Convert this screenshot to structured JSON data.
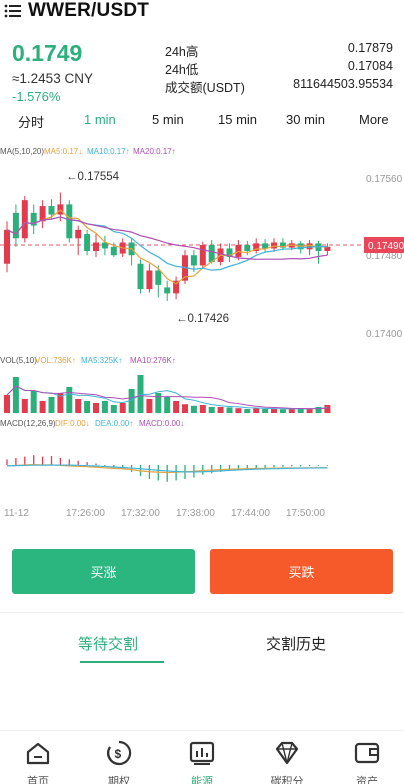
{
  "header": {
    "title": "WWER/USDT",
    "menu_icon": "menu-icon"
  },
  "ticker": {
    "last_price": "0.1749",
    "cny_price": "≈1.2453 CNY",
    "change_pct": "-1.576%",
    "stats": [
      {
        "label": "24h高",
        "value": "0.17879"
      },
      {
        "label": "24h低",
        "value": "0.17084"
      },
      {
        "label": "成交额(USDT)",
        "value": "811644503.95534"
      }
    ]
  },
  "intervals": {
    "items": [
      "分时",
      "1 min",
      "5 min",
      "15 min",
      "30 min",
      "More"
    ],
    "active": "1 min"
  },
  "chart": {
    "ma_legend": {
      "prefix": "MA(5,10,20)",
      "ma5": "MA5:0.17↓",
      "ma10": "MA10:0.17↑",
      "ma20": "MA20:0.17↑"
    },
    "vol_legend": {
      "prefix": "VOL(5,10)",
      "vol": "VOL:736K↑",
      "ma5": "MA5:325K↑",
      "ma10": "MA10:276K↑"
    },
    "macd_legend": {
      "prefix": "MACD(12,26,9)",
      "dif": "DIF:0.00↓",
      "dea": "DEA:0.00↑",
      "macd": "MACD:0.00↓"
    },
    "price_axis": [
      "0.17560",
      "0.17480",
      "0.17400"
    ],
    "current_price_tag": "0.17490",
    "high_marker": "←0.17554",
    "low_marker": "←0.17426",
    "time_axis": [
      "11-12",
      "17:26:00",
      "17:32:00",
      "17:38:00",
      "17:44:00",
      "17:50:00"
    ]
  },
  "actions": {
    "buy_label": "买涨",
    "sell_label": "买跌"
  },
  "order_tabs": {
    "pending": "等待交割",
    "history": "交割历史"
  },
  "nav": {
    "items": [
      {
        "label": "首页",
        "icon": "home-icon"
      },
      {
        "label": "期权",
        "icon": "dollar-cycle-icon"
      },
      {
        "label": "能源",
        "icon": "chart-icon"
      },
      {
        "label": "碳积分",
        "icon": "diamond-icon"
      },
      {
        "label": "资产",
        "icon": "wallet-icon"
      }
    ],
    "active": "能源"
  },
  "chart_data": {
    "type": "candlestick",
    "up_color": "#e23b4e",
    "down_color": "#2bb07c",
    "ylim": [
      0.1738,
      0.1759
    ],
    "candles": [
      {
        "o": 0.1747,
        "c": 0.1751,
        "h": 0.1752,
        "l": 0.1746
      },
      {
        "o": 0.1753,
        "c": 0.175,
        "h": 0.1754,
        "l": 0.1749
      },
      {
        "o": 0.175,
        "c": 0.17545,
        "h": 0.1755,
        "l": 0.17495
      },
      {
        "o": 0.1753,
        "c": 0.17515,
        "h": 0.1754,
        "l": 0.17505
      },
      {
        "o": 0.1752,
        "c": 0.17538,
        "h": 0.17545,
        "l": 0.17512
      },
      {
        "o": 0.17538,
        "c": 0.17528,
        "h": 0.17546,
        "l": 0.17522
      },
      {
        "o": 0.17528,
        "c": 0.1754,
        "h": 0.17554,
        "l": 0.1752
      },
      {
        "o": 0.1754,
        "c": 0.175,
        "h": 0.17545,
        "l": 0.17495
      },
      {
        "o": 0.175,
        "c": 0.1751,
        "h": 0.17515,
        "l": 0.1748
      },
      {
        "o": 0.17505,
        "c": 0.17485,
        "h": 0.1751,
        "l": 0.1748
      },
      {
        "o": 0.17485,
        "c": 0.17495,
        "h": 0.17505,
        "l": 0.17478
      },
      {
        "o": 0.17495,
        "c": 0.17488,
        "h": 0.17503,
        "l": 0.1748
      },
      {
        "o": 0.1749,
        "c": 0.1748,
        "h": 0.17495,
        "l": 0.17478
      },
      {
        "o": 0.17482,
        "c": 0.17495,
        "h": 0.175,
        "l": 0.17478
      },
      {
        "o": 0.17495,
        "c": 0.1748,
        "h": 0.175,
        "l": 0.17468
      },
      {
        "o": 0.1747,
        "c": 0.1744,
        "h": 0.17475,
        "l": 0.17435
      },
      {
        "o": 0.1744,
        "c": 0.17462,
        "h": 0.1747,
        "l": 0.17436
      },
      {
        "o": 0.17462,
        "c": 0.17445,
        "h": 0.17468,
        "l": 0.1743
      },
      {
        "o": 0.17442,
        "c": 0.17435,
        "h": 0.1745,
        "l": 0.17426
      },
      {
        "o": 0.17435,
        "c": 0.1745,
        "h": 0.17455,
        "l": 0.17428
      },
      {
        "o": 0.1745,
        "c": 0.1748,
        "h": 0.17486,
        "l": 0.17446
      },
      {
        "o": 0.1748,
        "c": 0.17468,
        "h": 0.17486,
        "l": 0.1746
      },
      {
        "o": 0.17468,
        "c": 0.17492,
        "h": 0.17496,
        "l": 0.17464
      },
      {
        "o": 0.17492,
        "c": 0.17472,
        "h": 0.17498,
        "l": 0.1747
      },
      {
        "o": 0.17472,
        "c": 0.17488,
        "h": 0.17494,
        "l": 0.17468
      },
      {
        "o": 0.17488,
        "c": 0.17478,
        "h": 0.17494,
        "l": 0.17472
      },
      {
        "o": 0.17478,
        "c": 0.17492,
        "h": 0.17498,
        "l": 0.17474
      },
      {
        "o": 0.17492,
        "c": 0.17485,
        "h": 0.17497,
        "l": 0.1748
      },
      {
        "o": 0.17485,
        "c": 0.17494,
        "h": 0.175,
        "l": 0.17482
      },
      {
        "o": 0.17494,
        "c": 0.17488,
        "h": 0.17499,
        "l": 0.17484
      },
      {
        "o": 0.17488,
        "c": 0.17495,
        "h": 0.175,
        "l": 0.17484
      },
      {
        "o": 0.17495,
        "c": 0.17489,
        "h": 0.175,
        "l": 0.17486
      },
      {
        "o": 0.17489,
        "c": 0.17494,
        "h": 0.17498,
        "l": 0.17486
      },
      {
        "o": 0.17494,
        "c": 0.17487,
        "h": 0.17497,
        "l": 0.17482
      },
      {
        "o": 0.17487,
        "c": 0.17494,
        "h": 0.17498,
        "l": 0.1748
      },
      {
        "o": 0.17494,
        "c": 0.17485,
        "h": 0.17497,
        "l": 0.1747
      },
      {
        "o": 0.17485,
        "c": 0.1749,
        "h": 0.17494,
        "l": 0.1748
      }
    ],
    "volumes": [
      0.45,
      0.9,
      0.35,
      0.55,
      0.3,
      0.4,
      0.5,
      0.65,
      0.35,
      0.3,
      0.25,
      0.3,
      0.2,
      0.25,
      0.6,
      0.95,
      0.35,
      0.5,
      0.4,
      0.3,
      0.22,
      0.18,
      0.2,
      0.15,
      0.15,
      0.14,
      0.12,
      0.1,
      0.12,
      0.1,
      0.1,
      0.09,
      0.1,
      0.12,
      0.1,
      0.15,
      0.2
    ],
    "macd_hist": [
      0.2,
      0.25,
      0.3,
      0.35,
      0.3,
      0.32,
      0.25,
      0.2,
      0.15,
      0.1,
      0.05,
      -0.05,
      -0.1,
      -0.15,
      -0.25,
      -0.4,
      -0.5,
      -0.55,
      -0.6,
      -0.55,
      -0.5,
      -0.45,
      -0.35,
      -0.3,
      -0.25,
      -0.2,
      -0.18,
      -0.15,
      -0.12,
      -0.1,
      -0.08,
      -0.06,
      -0.05,
      -0.05,
      -0.04,
      -0.03,
      -0.03
    ]
  }
}
